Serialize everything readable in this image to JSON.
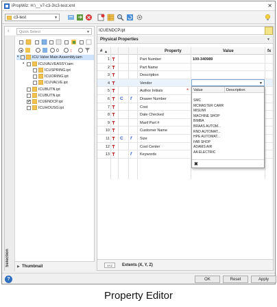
{
  "window": {
    "title": "iPropWiz: H:\\__v7-c3-3\\c3-test.xml"
  },
  "toolbar": {
    "project_combo": "c3-test"
  },
  "left_panel": {
    "search_placeholder": "Quick Select",
    "tree": [
      {
        "label": "ICU Valve Main Assembly.iam",
        "level": 0,
        "checked": false,
        "selected": true
      },
      {
        "label": "ICUVALVEASSY.iam",
        "level": 1,
        "checked": false
      },
      {
        "label": "ICUSPRING.ipt",
        "level": 2,
        "checked": false
      },
      {
        "label": "ICUORING.ipt",
        "level": 2,
        "checked": false
      },
      {
        "label": "ICUVALVE.ipt",
        "level": 2,
        "checked": false
      },
      {
        "label": "ICUBUTN.ipt",
        "level": 1,
        "checked": false
      },
      {
        "label": "ICUBUTN.ipt",
        "level": 1,
        "checked": false
      },
      {
        "label": "ICUENDCP.ipt",
        "level": 1,
        "checked": true
      },
      {
        "label": "ICUHOUSG.ipt",
        "level": 1,
        "checked": false
      }
    ],
    "side_tab": "Selection",
    "thumbnail_label": "Thumbnail"
  },
  "right_panel": {
    "file_name": "ICUENDCP.ipt",
    "section_title": "Physical Properties",
    "columns": {
      "num": "#",
      "property": "Property",
      "value": "Value",
      "fx": "fx"
    },
    "rows": [
      {
        "num": "1",
        "property": "Part Number",
        "value": "100-340989",
        "c": "",
        "fx": ""
      },
      {
        "num": "2",
        "property": "Part Name",
        "value": "",
        "c": "",
        "fx": ""
      },
      {
        "num": "3",
        "property": "Description",
        "value": "",
        "c": "",
        "fx": ""
      },
      {
        "num": "4",
        "property": "Vendor",
        "value": "",
        "c": "",
        "fx": ""
      },
      {
        "num": "5",
        "property": "Author Initials",
        "value": "",
        "c": "",
        "fx": ""
      },
      {
        "num": "6",
        "property": "Drawer Number",
        "value": "",
        "c": "C",
        "fx": "f"
      },
      {
        "num": "7",
        "property": "Cost",
        "value": "",
        "c": "",
        "fx": ""
      },
      {
        "num": "8",
        "property": "Date Checked",
        "value": "",
        "c": "",
        "fx": ""
      },
      {
        "num": "9",
        "property": "Manf Part #",
        "value": "",
        "c": "",
        "fx": ""
      },
      {
        "num": "10",
        "property": "Customer Name",
        "value": "",
        "c": "",
        "fx": ""
      },
      {
        "num": "11",
        "property": "Size",
        "value": "",
        "c": "C",
        "fx": "f"
      },
      {
        "num": "12",
        "property": "Cost Center",
        "value": "",
        "c": "",
        "fx": ""
      },
      {
        "num": "13",
        "property": "Keywords",
        "value": "",
        "c": "",
        "fx": "f"
      }
    ],
    "dropdown": {
      "col_value": "Value",
      "col_description": "Description",
      "options": [
        "SMC",
        "MCMASTER CARR",
        "MISUMI",
        "MACHINE SHOP",
        "BIMBA",
        "BRAAS AUTOM...",
        "RND AUTOMAT...",
        "HPE AUTOMAT...",
        "FAB SHOP",
        "ADAMS AIR",
        "AA ELECTRIC"
      ],
      "clear": "✖"
    },
    "extents_label": "Extents (X, Y, Z)",
    "xyz_icon": "XYZ"
  },
  "footer": {
    "help": "?",
    "ok": "OK",
    "reset": "Reset",
    "apply": "Apply"
  },
  "caption": "Property Editor"
}
